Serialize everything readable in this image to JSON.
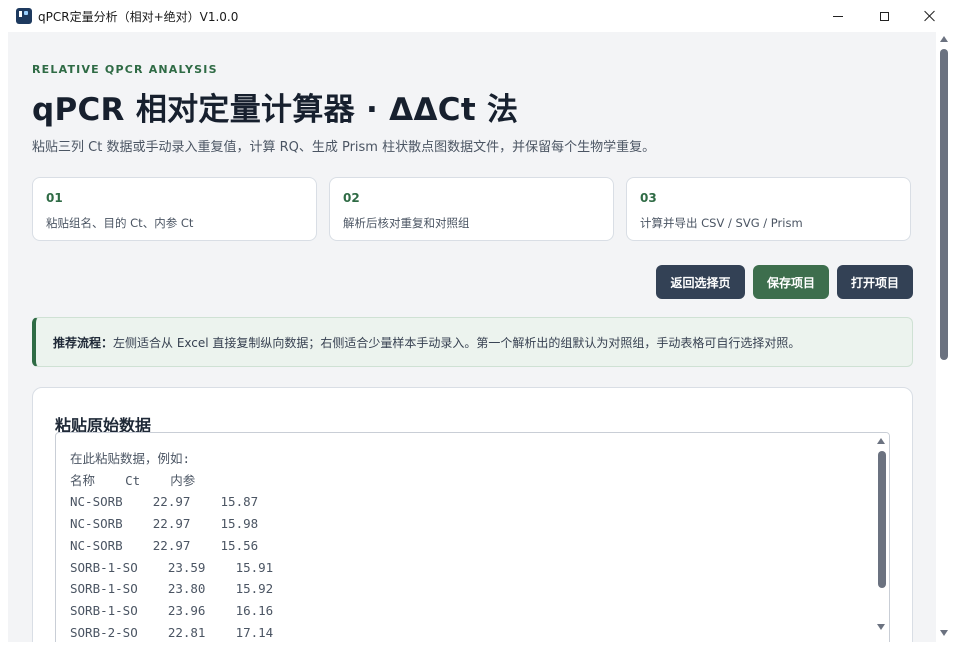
{
  "window": {
    "title": "qPCR定量分析（相对+绝对）V1.0.0",
    "icon": "app-icon"
  },
  "header": {
    "eyebrow": "RELATIVE QPCR ANALYSIS",
    "title": "qPCR 相对定量计算器 · ΔΔCt 法",
    "subtitle": "粘贴三列 Ct 数据或手动录入重复值，计算 RQ、生成 Prism 柱状散点图数据文件，并保留每个生物学重复。"
  },
  "steps": [
    {
      "num": "01",
      "text": "粘贴组名、目的 Ct、内参 Ct"
    },
    {
      "num": "02",
      "text": "解析后核对重复和对照组"
    },
    {
      "num": "03",
      "text": "计算并导出 CSV / SVG / Prism"
    }
  ],
  "toolbar": {
    "back_label": "返回选择页",
    "save_label": "保存项目",
    "open_label": "打开项目"
  },
  "tip": {
    "label": "推荐流程：",
    "text": "左侧适合从 Excel 直接复制纵向数据；右侧适合少量样本手动录入。第一个解析出的组默认为对照组，手动表格可自行选择对照。"
  },
  "paste_panel": {
    "title": "粘贴原始数据",
    "placeholder_lines": [
      "在此粘贴数据，例如:",
      "名称    Ct    内参",
      "NC-SORB    22.97    15.87",
      "NC-SORB    22.97    15.98",
      "NC-SORB    22.97    15.56",
      "SORB-1-SO    23.59    15.91",
      "SORB-1-SO    23.80    15.92",
      "SORB-1-SO    23.96    16.16",
      "SORB-2-SO    22.81    17.14"
    ]
  },
  "colors": {
    "accent_green": "#2f6b45",
    "button_dark": "#334155",
    "button_green": "#3d6e4d",
    "tip_background": "#ecf3ee"
  }
}
